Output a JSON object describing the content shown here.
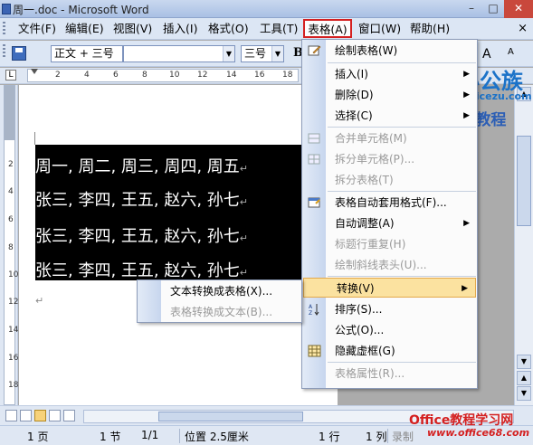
{
  "window": {
    "title": "周一.doc - Microsoft Word",
    "minimize": "–",
    "maximize": "□",
    "close": "✕"
  },
  "menubar": {
    "items": [
      "文件(F)",
      "编辑(E)",
      "视图(V)",
      "插入(I)",
      "格式(O)",
      "工具(T)",
      "表格(A)",
      "窗口(W)",
      "帮助(H)"
    ],
    "close": "×"
  },
  "toolbar": {
    "style_value": "正文 + 三号",
    "font_value": "",
    "size_value": "三号",
    "bold_label": "B",
    "font_grow": "A",
    "font_shrink": "A"
  },
  "ruler": {
    "ticks": [
      "2",
      "4",
      "6",
      "8",
      "10",
      "12",
      "14",
      "16",
      "18"
    ]
  },
  "vruler": {
    "ticks": [
      "2",
      "4",
      "6",
      "8",
      "10",
      "12",
      "14",
      "16",
      "18"
    ]
  },
  "document": {
    "lines": [
      "周一, 周二, 周三, 周四, 周五",
      "张三, 李四, 王五, 赵六, 孙七",
      "张三, 李四, 王五, 赵六, 孙七",
      "张三, 李四, 王五, 赵六, 孙七"
    ],
    "para_mark": "↵"
  },
  "table_menu": {
    "items": [
      {
        "label": "绘制表格(W)",
        "icon": "pencil-icon",
        "enabled": true
      },
      {
        "label": "插入(I)",
        "enabled": true,
        "submenu": true
      },
      {
        "label": "删除(D)",
        "enabled": true,
        "submenu": true
      },
      {
        "label": "选择(C)",
        "enabled": true,
        "submenu": true
      },
      {
        "label": "合并单元格(M)",
        "icon": "merge-cells-icon",
        "enabled": false
      },
      {
        "label": "拆分单元格(P)...",
        "icon": "split-cells-icon",
        "enabled": false
      },
      {
        "label": "拆分表格(T)",
        "enabled": false
      },
      {
        "label": "表格自动套用格式(F)...",
        "icon": "autoformat-icon",
        "enabled": true
      },
      {
        "label": "自动调整(A)",
        "enabled": true,
        "submenu": true
      },
      {
        "label": "标题行重复(H)",
        "enabled": false
      },
      {
        "label": "绘制斜线表头(U)...",
        "enabled": false
      },
      {
        "label": "转换(V)",
        "enabled": true,
        "submenu": true,
        "highlighted": true
      },
      {
        "label": "排序(S)...",
        "icon": "sort-az-icon",
        "enabled": true
      },
      {
        "label": "公式(O)...",
        "enabled": true
      },
      {
        "label": "隐藏虚框(G)",
        "icon": "gridlines-icon",
        "enabled": true
      },
      {
        "label": "表格属性(R)...",
        "enabled": false
      }
    ]
  },
  "convert_submenu": {
    "items": [
      {
        "label": "文本转换成表格(X)...",
        "enabled": true
      },
      {
        "label": "表格转换成文本(B)...",
        "enabled": false
      }
    ]
  },
  "statusbar": {
    "page": "1 页",
    "section": "1 节",
    "page_of": "1/1",
    "position": "位置 2.5厘米",
    "line": "1 行",
    "column": "1 列",
    "record": "录制"
  },
  "watermarks": {
    "brand_cn": "办公族",
    "brand_url": "Officezu.com",
    "brand_word": "Word教程",
    "site_cn": "Office教程学习网",
    "site_url": "www.office68.com"
  },
  "colors": {
    "menu_highlight": "#fbe2a0",
    "table_menu_border": "#d42020",
    "selection": "#000000"
  }
}
